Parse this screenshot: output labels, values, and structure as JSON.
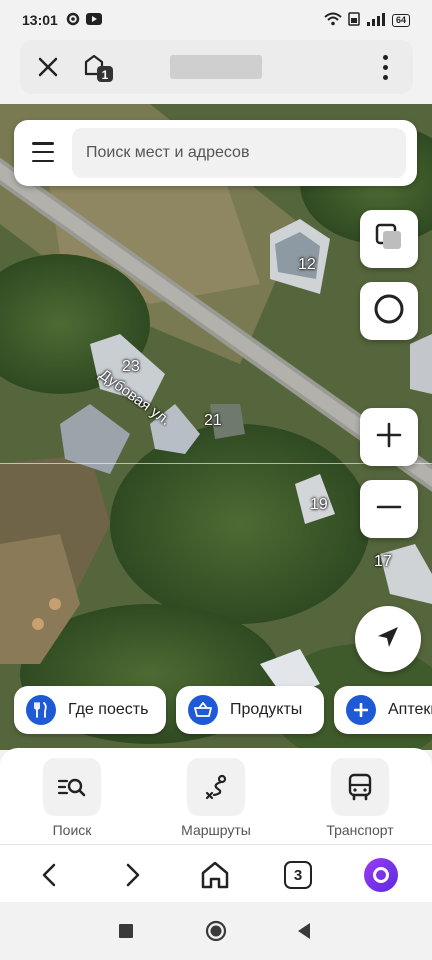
{
  "status_bar": {
    "time": "13:01",
    "battery": "64"
  },
  "browser": {
    "tab_count_top": "1",
    "tab_count_bottom": "3"
  },
  "search": {
    "placeholder": "Поиск мест и адресов"
  },
  "map": {
    "street": "Дубовая ул.",
    "house_numbers": [
      "12",
      "23",
      "21",
      "19",
      "17"
    ]
  },
  "chips": [
    {
      "label": "Где поесть",
      "icon": "fork-knife-icon"
    },
    {
      "label": "Продукты",
      "icon": "basket-icon"
    },
    {
      "label": "Аптеки",
      "icon": "plus-icon"
    }
  ],
  "bottom_nav": [
    {
      "label": "Поиск",
      "icon": "search-list-icon"
    },
    {
      "label": "Маршруты",
      "icon": "route-icon"
    },
    {
      "label": "Транспорт",
      "icon": "bus-icon"
    }
  ],
  "colors": {
    "accent": "#1f5ad6",
    "alice": "#7a34ec"
  }
}
